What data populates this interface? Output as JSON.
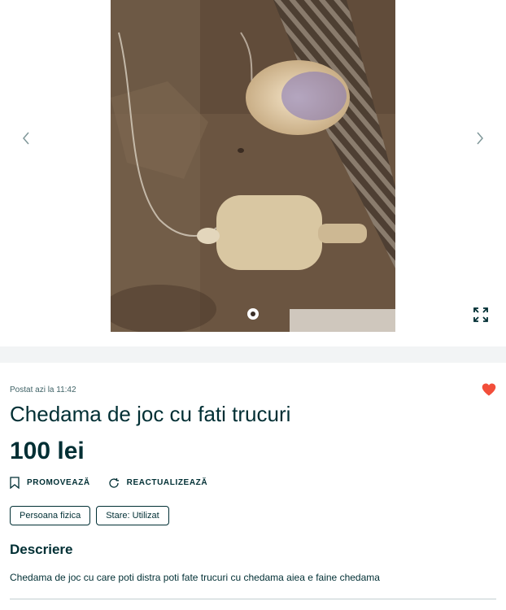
{
  "gallery": {
    "prev_icon": "chevron-left-icon",
    "next_icon": "chevron-right-icon",
    "expand_icon": "expand-icon"
  },
  "listing": {
    "posted": "Postat azi la 11:42",
    "title": "Chedama de joc cu fati trucuri",
    "price": "100 lei",
    "favorite_icon": "heart-icon",
    "favorite_color": "#f24e3a"
  },
  "actions": {
    "promote": "PROMOVEAZĂ",
    "refresh": "REACTUALIZEAZĂ"
  },
  "tags": [
    "Persoana fizica",
    "Stare: Utilizat"
  ],
  "description": {
    "heading": "Descriere",
    "text": "Chedama de joc cu care poti distra poti fate trucuri cu chedama aiea e faine chedama"
  }
}
